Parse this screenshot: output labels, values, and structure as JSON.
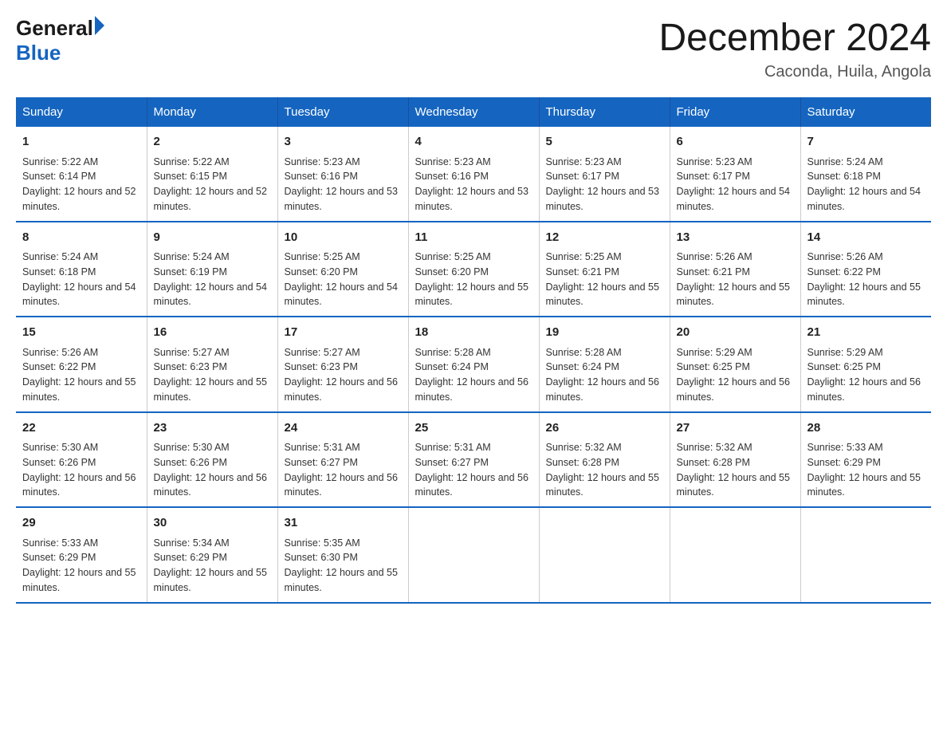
{
  "logo": {
    "general": "General",
    "blue": "Blue"
  },
  "title": "December 2024",
  "location": "Caconda, Huila, Angola",
  "days_of_week": [
    "Sunday",
    "Monday",
    "Tuesday",
    "Wednesday",
    "Thursday",
    "Friday",
    "Saturday"
  ],
  "weeks": [
    [
      {
        "day": "1",
        "sunrise": "5:22 AM",
        "sunset": "6:14 PM",
        "daylight": "12 hours and 52 minutes."
      },
      {
        "day": "2",
        "sunrise": "5:22 AM",
        "sunset": "6:15 PM",
        "daylight": "12 hours and 52 minutes."
      },
      {
        "day": "3",
        "sunrise": "5:23 AM",
        "sunset": "6:16 PM",
        "daylight": "12 hours and 53 minutes."
      },
      {
        "day": "4",
        "sunrise": "5:23 AM",
        "sunset": "6:16 PM",
        "daylight": "12 hours and 53 minutes."
      },
      {
        "day": "5",
        "sunrise": "5:23 AM",
        "sunset": "6:17 PM",
        "daylight": "12 hours and 53 minutes."
      },
      {
        "day": "6",
        "sunrise": "5:23 AM",
        "sunset": "6:17 PM",
        "daylight": "12 hours and 54 minutes."
      },
      {
        "day": "7",
        "sunrise": "5:24 AM",
        "sunset": "6:18 PM",
        "daylight": "12 hours and 54 minutes."
      }
    ],
    [
      {
        "day": "8",
        "sunrise": "5:24 AM",
        "sunset": "6:18 PM",
        "daylight": "12 hours and 54 minutes."
      },
      {
        "day": "9",
        "sunrise": "5:24 AM",
        "sunset": "6:19 PM",
        "daylight": "12 hours and 54 minutes."
      },
      {
        "day": "10",
        "sunrise": "5:25 AM",
        "sunset": "6:20 PM",
        "daylight": "12 hours and 54 minutes."
      },
      {
        "day": "11",
        "sunrise": "5:25 AM",
        "sunset": "6:20 PM",
        "daylight": "12 hours and 55 minutes."
      },
      {
        "day": "12",
        "sunrise": "5:25 AM",
        "sunset": "6:21 PM",
        "daylight": "12 hours and 55 minutes."
      },
      {
        "day": "13",
        "sunrise": "5:26 AM",
        "sunset": "6:21 PM",
        "daylight": "12 hours and 55 minutes."
      },
      {
        "day": "14",
        "sunrise": "5:26 AM",
        "sunset": "6:22 PM",
        "daylight": "12 hours and 55 minutes."
      }
    ],
    [
      {
        "day": "15",
        "sunrise": "5:26 AM",
        "sunset": "6:22 PM",
        "daylight": "12 hours and 55 minutes."
      },
      {
        "day": "16",
        "sunrise": "5:27 AM",
        "sunset": "6:23 PM",
        "daylight": "12 hours and 55 minutes."
      },
      {
        "day": "17",
        "sunrise": "5:27 AM",
        "sunset": "6:23 PM",
        "daylight": "12 hours and 56 minutes."
      },
      {
        "day": "18",
        "sunrise": "5:28 AM",
        "sunset": "6:24 PM",
        "daylight": "12 hours and 56 minutes."
      },
      {
        "day": "19",
        "sunrise": "5:28 AM",
        "sunset": "6:24 PM",
        "daylight": "12 hours and 56 minutes."
      },
      {
        "day": "20",
        "sunrise": "5:29 AM",
        "sunset": "6:25 PM",
        "daylight": "12 hours and 56 minutes."
      },
      {
        "day": "21",
        "sunrise": "5:29 AM",
        "sunset": "6:25 PM",
        "daylight": "12 hours and 56 minutes."
      }
    ],
    [
      {
        "day": "22",
        "sunrise": "5:30 AM",
        "sunset": "6:26 PM",
        "daylight": "12 hours and 56 minutes."
      },
      {
        "day": "23",
        "sunrise": "5:30 AM",
        "sunset": "6:26 PM",
        "daylight": "12 hours and 56 minutes."
      },
      {
        "day": "24",
        "sunrise": "5:31 AM",
        "sunset": "6:27 PM",
        "daylight": "12 hours and 56 minutes."
      },
      {
        "day": "25",
        "sunrise": "5:31 AM",
        "sunset": "6:27 PM",
        "daylight": "12 hours and 56 minutes."
      },
      {
        "day": "26",
        "sunrise": "5:32 AM",
        "sunset": "6:28 PM",
        "daylight": "12 hours and 55 minutes."
      },
      {
        "day": "27",
        "sunrise": "5:32 AM",
        "sunset": "6:28 PM",
        "daylight": "12 hours and 55 minutes."
      },
      {
        "day": "28",
        "sunrise": "5:33 AM",
        "sunset": "6:29 PM",
        "daylight": "12 hours and 55 minutes."
      }
    ],
    [
      {
        "day": "29",
        "sunrise": "5:33 AM",
        "sunset": "6:29 PM",
        "daylight": "12 hours and 55 minutes."
      },
      {
        "day": "30",
        "sunrise": "5:34 AM",
        "sunset": "6:29 PM",
        "daylight": "12 hours and 55 minutes."
      },
      {
        "day": "31",
        "sunrise": "5:35 AM",
        "sunset": "6:30 PM",
        "daylight": "12 hours and 55 minutes."
      },
      {
        "day": "",
        "sunrise": "",
        "sunset": "",
        "daylight": ""
      },
      {
        "day": "",
        "sunrise": "",
        "sunset": "",
        "daylight": ""
      },
      {
        "day": "",
        "sunrise": "",
        "sunset": "",
        "daylight": ""
      },
      {
        "day": "",
        "sunrise": "",
        "sunset": "",
        "daylight": ""
      }
    ]
  ]
}
